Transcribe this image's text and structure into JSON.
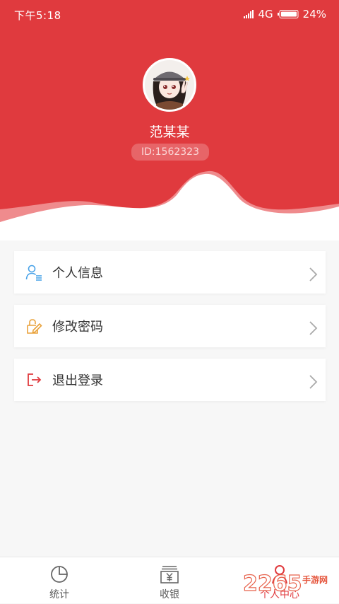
{
  "status_bar": {
    "time": "下午5:18",
    "network": "4G",
    "battery": "24%"
  },
  "profile": {
    "name": "范某某",
    "id": "ID:1562323"
  },
  "menu": [
    {
      "label": "个人信息",
      "icon": "user-info-icon"
    },
    {
      "label": "修改密码",
      "icon": "edit-password-icon"
    },
    {
      "label": "退出登录",
      "icon": "logout-icon"
    }
  ],
  "nav": [
    {
      "label": "统计",
      "icon": "pie-chart-icon"
    },
    {
      "label": "收银",
      "icon": "cashier-icon"
    },
    {
      "label": "个人中心",
      "icon": "person-icon",
      "active": true
    }
  ],
  "watermark": {
    "logo": "2265",
    "text": "手游网"
  },
  "colors": {
    "primary": "#e03a3e",
    "wave_mid": "#ef8b8d",
    "text": "#333333",
    "nav_text": "#555555"
  }
}
